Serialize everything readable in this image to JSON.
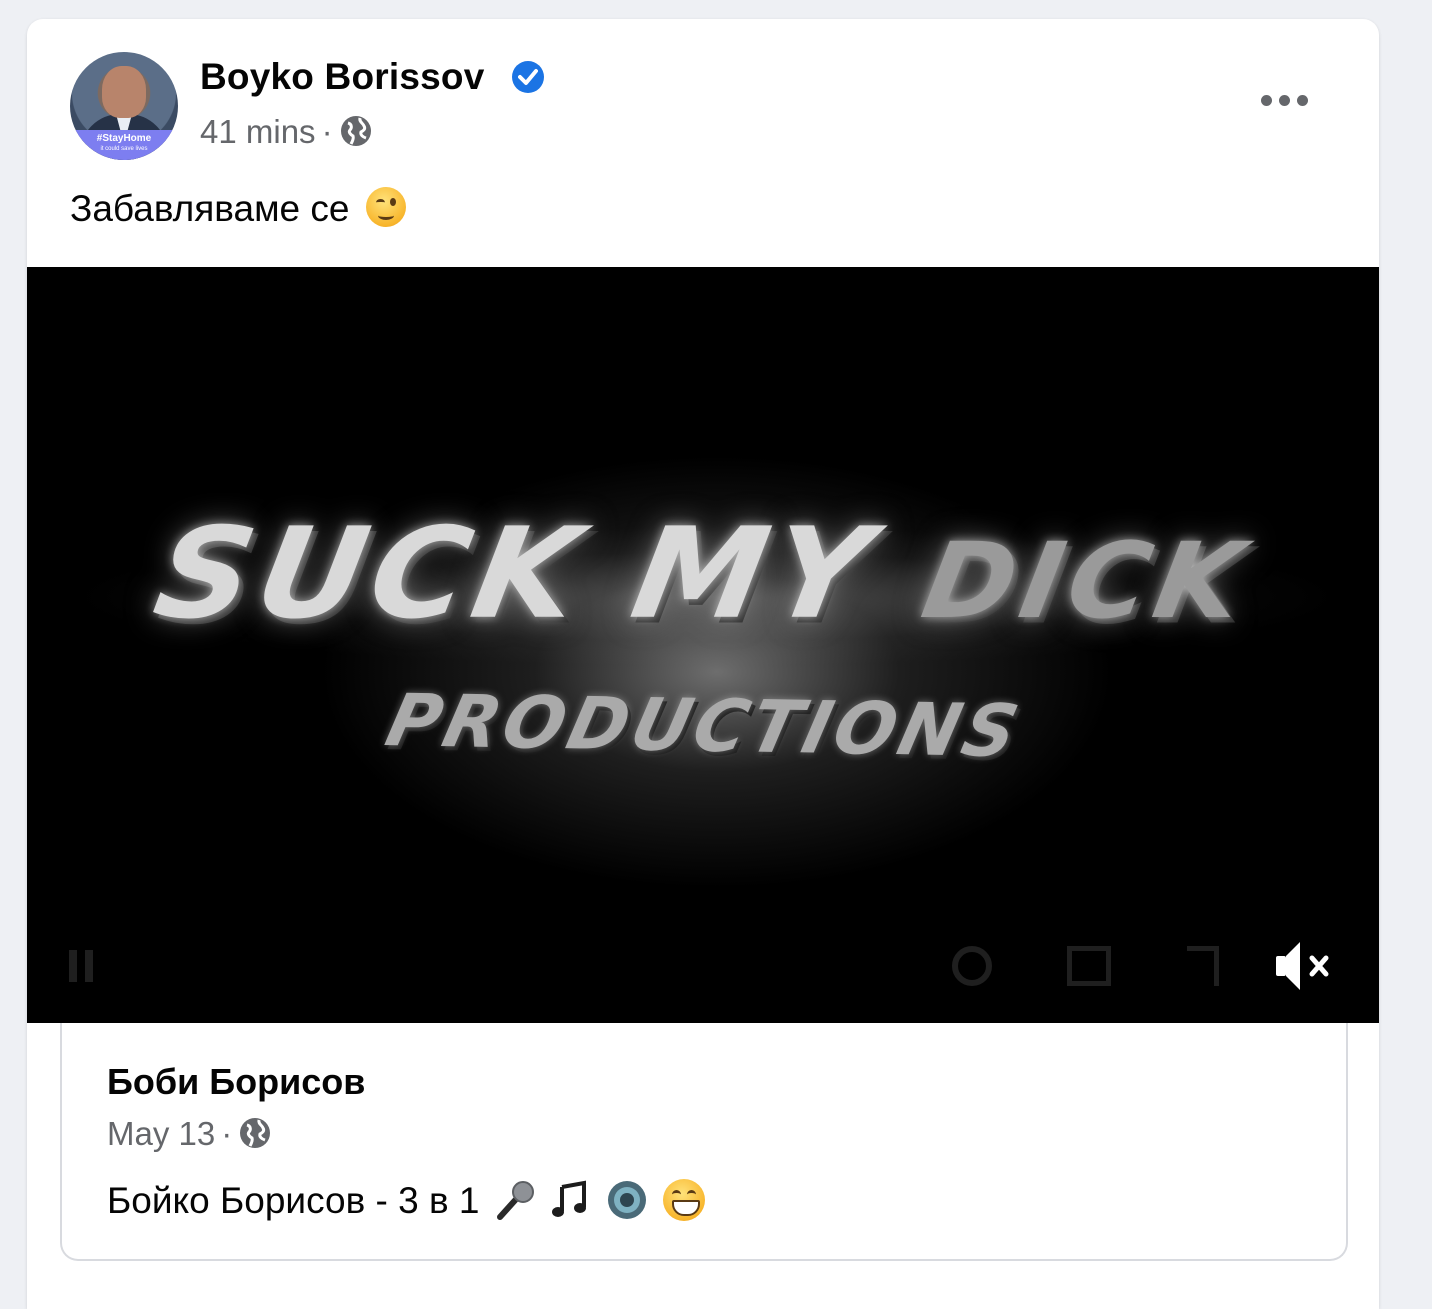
{
  "post": {
    "author": "Boyko Borissov",
    "timestamp": "41 mins",
    "separator": "·",
    "caption": "Забавляваме се",
    "avatar": {
      "badge_text": "#StayHome",
      "badge_subtext": "it could save lives"
    },
    "icons": {
      "verified": "verified-badge-icon",
      "audience": "globe-icon",
      "more": "more-options-icon",
      "caption_emoji": "winking-face-emoji"
    }
  },
  "video": {
    "title_line1_a": "SUCK MY",
    "title_line1_b": "DICK",
    "title_line2": "PRODUCTIONS",
    "muted": true,
    "icons": {
      "mute": "volume-muted-icon"
    }
  },
  "shared_post": {
    "author": "Боби Борисов",
    "date": "May 13",
    "separator": "·",
    "text": "Бойко Борисов - 3 в 1",
    "emojis": [
      "microphone-emoji",
      "music-note-emoji",
      "speaker-emoji",
      "grinning-face-emoji"
    ]
  },
  "colors": {
    "verified_blue": "#1b74e4",
    "secondary_text": "#65676b",
    "primary_text": "#050505",
    "page_background": "#eef0f4"
  }
}
